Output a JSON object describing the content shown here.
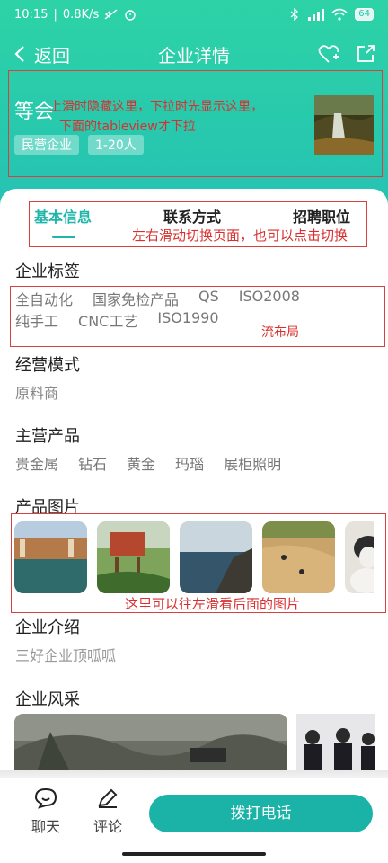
{
  "status_bar": {
    "time": "10:15",
    "speed": "0.8K/s",
    "battery": "64"
  },
  "nav": {
    "back_label": "返回",
    "title": "企业详情"
  },
  "company": {
    "name": "等会",
    "tags": [
      "民营企业",
      "1-20人"
    ]
  },
  "tabs": [
    {
      "label": "基本信息",
      "active": true
    },
    {
      "label": "联系方式",
      "active": false
    },
    {
      "label": "招聘职位",
      "active": false
    }
  ],
  "sections": {
    "tags_title": "企业标签",
    "tags_row1": [
      "全自动化",
      "国家免检产品",
      "QS",
      "ISO2008"
    ],
    "tags_row2": [
      "纯手工",
      "CNC工艺",
      "ISO1990"
    ],
    "mode_title": "经营模式",
    "mode_value": "原料商",
    "products_title": "主营产品",
    "products": [
      "贵金属",
      "钻石",
      "黄金",
      "玛瑙",
      "展柜照明"
    ],
    "images_title": "产品图片",
    "intro_title": "企业介绍",
    "intro_value": "三好企业顶呱呱",
    "style_title": "企业风采"
  },
  "annotations": {
    "header_note_line1": "上滑时隐藏这里，下拉时先显示这里，",
    "header_note_line2": "下面的tableview才下拉",
    "tabs_note": "左右滑动切换页面，也可以点击切换",
    "tags_note": "流布局",
    "photos_note": "这里可以往左滑看后面的图片"
  },
  "bottom_bar": {
    "chat_label": "聊天",
    "comment_label": "评论",
    "call_label": "拨打电话"
  },
  "colors": {
    "accent": "#1fb5a8",
    "header_gradient_top": "#2dd3a6",
    "annotation": "#d83030"
  },
  "icons": [
    "back-arrow-icon",
    "heart-add-icon",
    "share-icon",
    "chat-icon",
    "edit-icon"
  ]
}
